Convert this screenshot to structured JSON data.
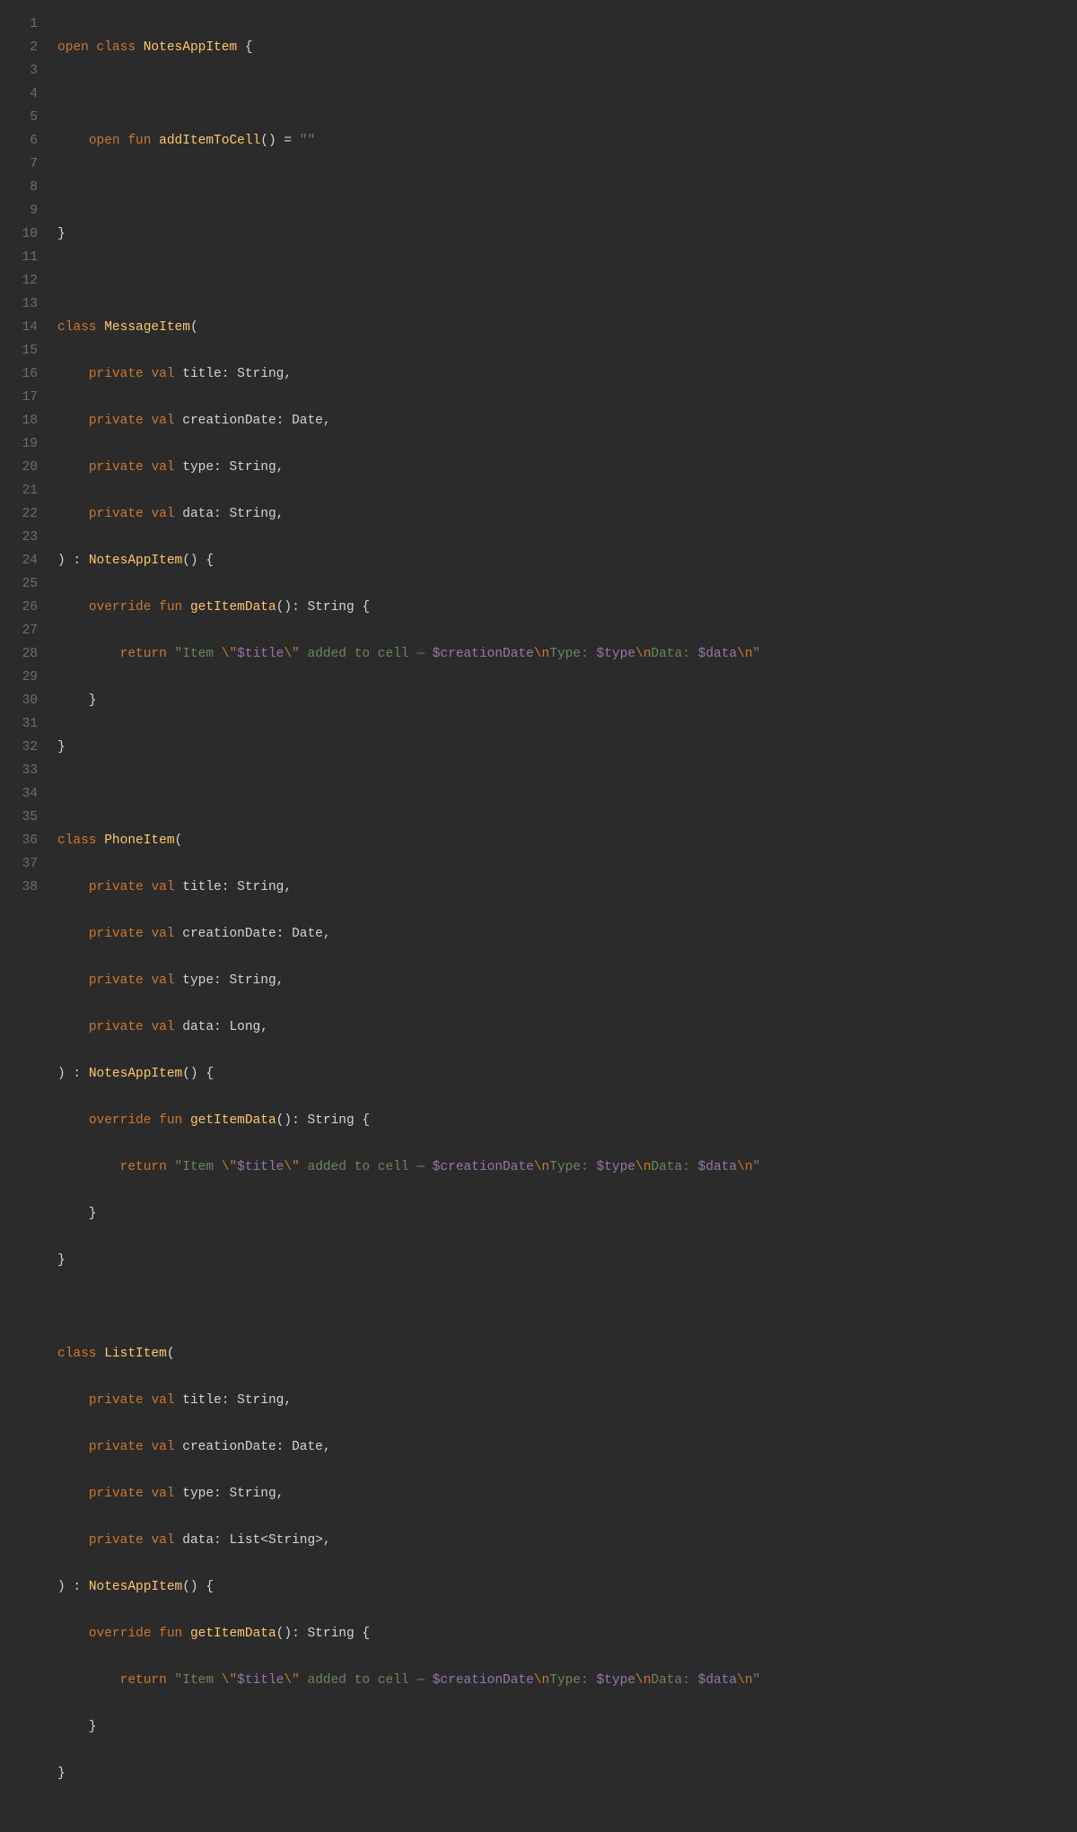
{
  "lineNumbers": [
    "1",
    "2",
    "3",
    "4",
    "5",
    "6",
    "7",
    "8",
    "9",
    "10",
    "11",
    "12",
    "13",
    "14",
    "15",
    "16",
    "17",
    "18",
    "19",
    "20",
    "21",
    "22",
    "23",
    "24",
    "25",
    "26",
    "27",
    "28",
    "29",
    "30",
    "31",
    "32",
    "33",
    "34",
    "35",
    "36",
    "37",
    "38"
  ],
  "code": {
    "l1": {
      "t1": "open",
      "t2": " ",
      "t3": "class",
      "t4": " ",
      "t5": "NotesAppItem",
      "t6": " {"
    },
    "l2": "",
    "l3": {
      "t1": "    ",
      "t2": "open",
      "t3": " ",
      "t4": "fun",
      "t5": " ",
      "t6": "addItemToCell",
      "t7": "() = ",
      "t8": "\"\""
    },
    "l4": "",
    "l5": {
      "t1": "}"
    },
    "l6": "",
    "l7": {
      "t1": "class",
      "t2": " ",
      "t3": "MessageItem",
      "t4": "("
    },
    "l8": {
      "t1": "    ",
      "t2": "private",
      "t3": " ",
      "t4": "val",
      "t5": " title: String,"
    },
    "l9": {
      "t1": "    ",
      "t2": "private",
      "t3": " ",
      "t4": "val",
      "t5": " creationDate: Date,"
    },
    "l10": {
      "t1": "    ",
      "t2": "private",
      "t3": " ",
      "t4": "val",
      "t5": " type: String,"
    },
    "l11": {
      "t1": "    ",
      "t2": "private",
      "t3": " ",
      "t4": "val",
      "t5": " data: String,"
    },
    "l12": {
      "t1": ") : ",
      "t2": "NotesAppItem",
      "t3": "() {"
    },
    "l13": {
      "t1": "    ",
      "t2": "override",
      "t3": " ",
      "t4": "fun",
      "t5": " ",
      "t6": "getItemData",
      "t7": "(): String {"
    },
    "l14": {
      "t1": "        ",
      "t2": "return",
      "t3": " ",
      "q1": "\"Item ",
      "e1": "\\\"",
      "v1": "$title",
      "e2": "\\\"",
      "s2": " added to cell — ",
      "v2": "$creationDate",
      "e3": "\\n",
      "s3": "Type: ",
      "v3": "$type",
      "e4": "\\n",
      "s4": "Data: ",
      "v4": "$data",
      "e5": "\\n",
      "q2": "\""
    },
    "l15": {
      "t1": "    }"
    },
    "l16": {
      "t1": "}"
    },
    "l17": "",
    "l18": {
      "t1": "class",
      "t2": " ",
      "t3": "PhoneItem",
      "t4": "("
    },
    "l19": {
      "t1": "    ",
      "t2": "private",
      "t3": " ",
      "t4": "val",
      "t5": " title: String,"
    },
    "l20": {
      "t1": "    ",
      "t2": "private",
      "t3": " ",
      "t4": "val",
      "t5": " creationDate: Date,"
    },
    "l21": {
      "t1": "    ",
      "t2": "private",
      "t3": " ",
      "t4": "val",
      "t5": " type: String,"
    },
    "l22": {
      "t1": "    ",
      "t2": "private",
      "t3": " ",
      "t4": "val",
      "t5": " data: Long,"
    },
    "l23": {
      "t1": ") : ",
      "t2": "NotesAppItem",
      "t3": "() {"
    },
    "l24": {
      "t1": "    ",
      "t2": "override",
      "t3": " ",
      "t4": "fun",
      "t5": " ",
      "t6": "getItemData",
      "t7": "(): String {"
    },
    "l25": {
      "t1": "        ",
      "t2": "return",
      "t3": " ",
      "q1": "\"Item ",
      "e1": "\\\"",
      "v1": "$title",
      "e2": "\\\"",
      "s2": " added to cell — ",
      "v2": "$creationDate",
      "e3": "\\n",
      "s3": "Type: ",
      "v3": "$type",
      "e4": "\\n",
      "s4": "Data: ",
      "v4": "$data",
      "e5": "\\n",
      "q2": "\""
    },
    "l26": {
      "t1": "    }"
    },
    "l27": {
      "t1": "}"
    },
    "l28": "",
    "l29": {
      "t1": "class",
      "t2": " ",
      "t3": "ListItem",
      "t4": "("
    },
    "l30": {
      "t1": "    ",
      "t2": "private",
      "t3": " ",
      "t4": "val",
      "t5": " title: String,"
    },
    "l31": {
      "t1": "    ",
      "t2": "private",
      "t3": " ",
      "t4": "val",
      "t5": " creationDate: Date,"
    },
    "l32": {
      "t1": "    ",
      "t2": "private",
      "t3": " ",
      "t4": "val",
      "t5": " type: String,"
    },
    "l33": {
      "t1": "    ",
      "t2": "private",
      "t3": " ",
      "t4": "val",
      "t5": " data: List<String>,"
    },
    "l34": {
      "t1": ") : ",
      "t2": "NotesAppItem",
      "t3": "() {"
    },
    "l35": {
      "t1": "    ",
      "t2": "override",
      "t3": " ",
      "t4": "fun",
      "t5": " ",
      "t6": "getItemData",
      "t7": "(): String {"
    },
    "l36": {
      "t1": "        ",
      "t2": "return",
      "t3": " ",
      "q1": "\"Item ",
      "e1": "\\\"",
      "v1": "$title",
      "e2": "\\\"",
      "s2": " added to cell — ",
      "v2": "$creationDate",
      "e3": "\\n",
      "s3": "Type: ",
      "v3": "$type",
      "e4": "\\n",
      "s4": "Data: ",
      "v4": "$data",
      "e5": "\\n",
      "q2": "\""
    },
    "l37": {
      "t1": "    }"
    },
    "l38": {
      "t1": "}"
    }
  }
}
